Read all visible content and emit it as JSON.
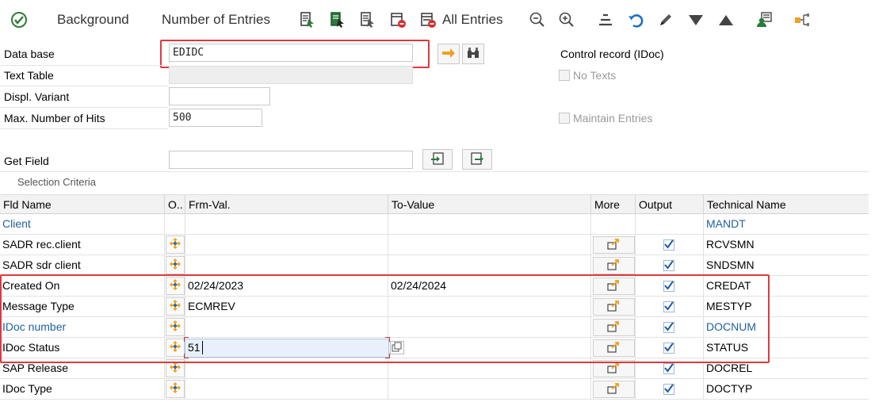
{
  "toolbar": {
    "execute_icon": "execute-check-icon",
    "background": "Background",
    "number_of_entries": "Number of Entries",
    "all_entries": "All Entries",
    "icons": [
      "select-all-icon",
      "select-green-icon",
      "select-block-icon",
      "delete-selection-icon",
      "delete-entries-icon",
      "zoom-out-icon",
      "zoom-in-icon",
      "align-icon",
      "undo-icon",
      "edit-pencil-icon",
      "triangle-down-icon",
      "triangle-up-icon",
      "user-settings-icon",
      "hierarchy-icon"
    ]
  },
  "form": {
    "data_base_label": "Data base",
    "data_base_value": "EDIDC",
    "text_table_label": "Text Table",
    "text_table_value": "",
    "displ_variant_label": "Displ. Variant",
    "displ_variant_value": "",
    "max_hits_label": "Max. Number of Hits",
    "max_hits_value": "500",
    "get_field_label": "Get Field",
    "get_field_value": "",
    "table_desc": "Control record (IDoc)",
    "no_texts": "No Texts",
    "maintain_entries": "Maintain Entries"
  },
  "selection": {
    "title": "Selection Criteria",
    "headers": {
      "fld_name": "Fld Name",
      "o": "O..",
      "frm_val": "Frm-Val.",
      "to_value": "To-Value",
      "more": "More",
      "output": "Output",
      "technical_name": "Technical Name"
    },
    "rows": [
      {
        "name": "Client",
        "from": "",
        "to": "",
        "tech": "MANDT",
        "blue": true,
        "has_sel": false
      },
      {
        "name": "SADR rec.client",
        "from": "",
        "to": "",
        "tech": "RCVSMN",
        "blue": false,
        "has_sel": true
      },
      {
        "name": "SADR sdr client",
        "from": "",
        "to": "",
        "tech": "SNDSMN",
        "blue": false,
        "has_sel": true
      },
      {
        "name": "Created On",
        "from": "02/24/2023",
        "to": "02/24/2024",
        "tech": "CREDAT",
        "blue": false,
        "has_sel": true
      },
      {
        "name": "Message Type",
        "from": "ECMREV",
        "to": "",
        "tech": "MESTYP",
        "blue": false,
        "has_sel": true
      },
      {
        "name": "IDoc number",
        "from": "",
        "to": "",
        "tech": "DOCNUM",
        "blue": true,
        "has_sel": true
      },
      {
        "name": "IDoc Status",
        "from": "51",
        "to": "",
        "tech": "STATUS",
        "blue": false,
        "has_sel": true
      },
      {
        "name": "SAP Release",
        "from": "",
        "to": "",
        "tech": "DOCREL",
        "blue": false,
        "has_sel": true
      },
      {
        "name": "IDoc Type",
        "from": "",
        "to": "",
        "tech": "DOCTYP",
        "blue": false,
        "has_sel": true
      }
    ]
  },
  "colors": {
    "highlight_red": "#e0393e",
    "link_blue": "#1f5fa8",
    "accent_orange": "#f0a020"
  }
}
